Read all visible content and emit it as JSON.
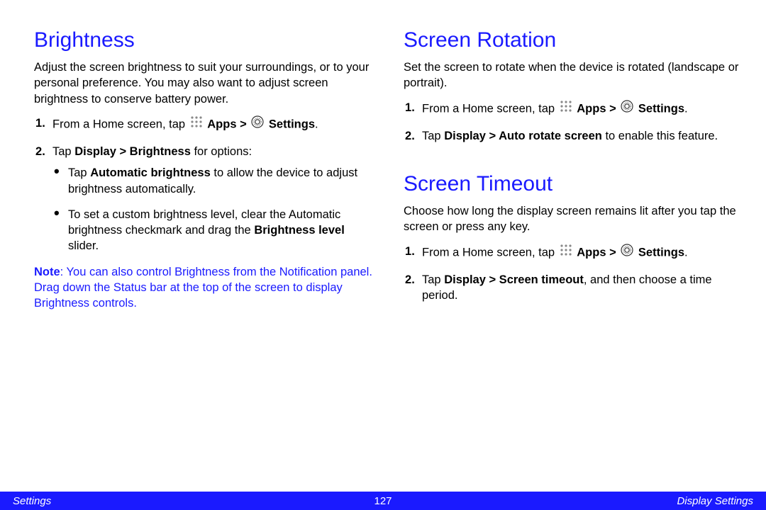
{
  "left": {
    "heading": "Brightness",
    "intro": "Adjust the screen brightness to suit your surroundings, or to your personal preference. You may also want to adjust screen brightness to conserve battery power.",
    "step1_prefix": "From a Home screen, tap ",
    "apps_label": "Apps",
    "gt": " > ",
    "settings_label": "Settings",
    "period": ".",
    "step2_prefix": "Tap ",
    "step2_bold": "Display > Brightness",
    "step2_suffix": " for options:",
    "bullet1_a": "Tap ",
    "bullet1_b": "Automatic brightness",
    "bullet1_c": " to allow the device to adjust brightness automatically.",
    "bullet2_a": "To set a custom brightness level, clear the Automatic brightness checkmark and drag the ",
    "bullet2_b": "Brightness level",
    "bullet2_c": " slider.",
    "note_label": "Note",
    "note_body": ": You can also control Brightness from the Notification panel. Drag down the Status bar at the top of the screen to display Brightness controls."
  },
  "rotation": {
    "heading": "Screen Rotation",
    "intro": "Set the screen to rotate when the device is rotated (landscape or portrait).",
    "step2_a": "Tap ",
    "step2_b": "Display > Auto rotate screen",
    "step2_c": " to enable this feature."
  },
  "timeout": {
    "heading": "Screen Timeout",
    "intro": "Choose how long the display screen remains lit after you tap the screen or press any key.",
    "step2_a": "Tap ",
    "step2_b": "Display > Screen timeout",
    "step2_c": ", and then choose a time period."
  },
  "footer": {
    "left": "Settings",
    "center": "127",
    "right": "Display Settings"
  }
}
